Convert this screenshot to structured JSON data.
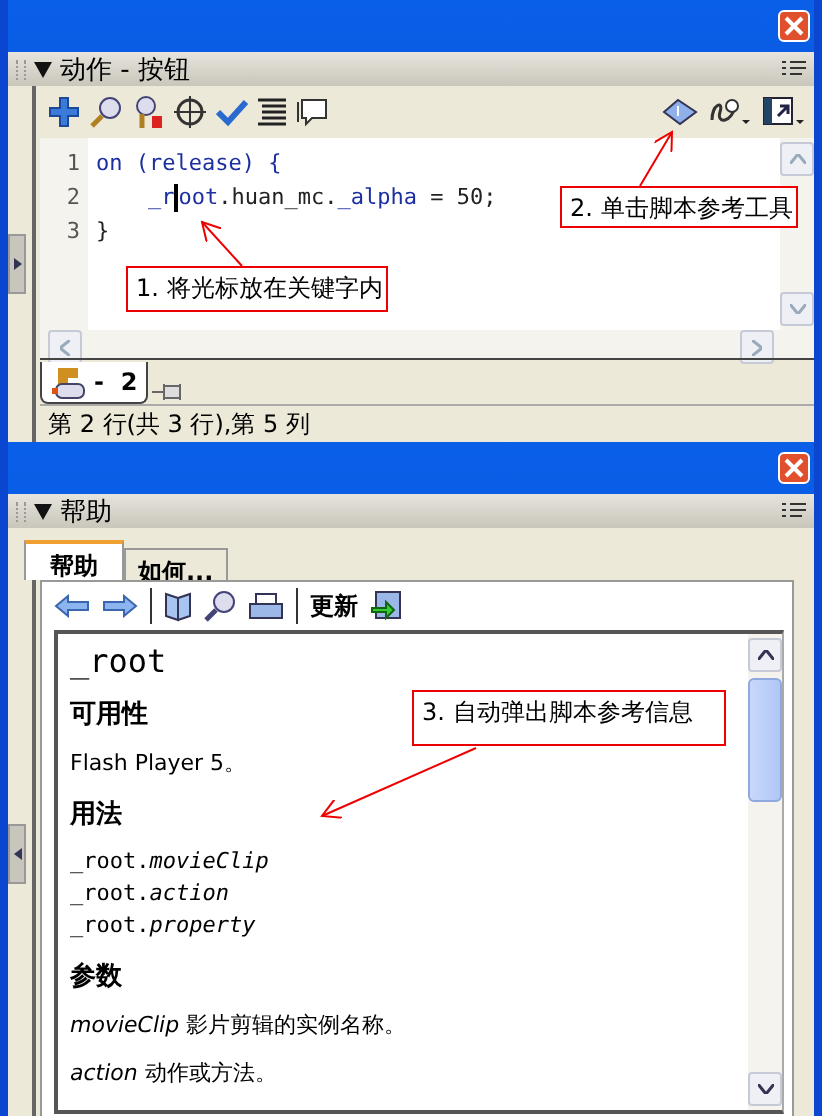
{
  "action_panel": {
    "header": "动作 - 按钮",
    "code_lines": [
      {
        "number": "1",
        "tokens": [
          {
            "kind": "keyword",
            "text": "on (release) {"
          }
        ]
      },
      {
        "number": "2",
        "indented": true,
        "tokens": [
          {
            "kind": "keyword",
            "text": "_r"
          },
          {
            "kind": "cursor"
          },
          {
            "kind": "keyword",
            "text": "oot"
          },
          {
            "kind": "plain",
            "text": ".huan_mc."
          },
          {
            "kind": "keyword",
            "text": "_alpha"
          },
          {
            "kind": "plain",
            "text": " = 50;"
          }
        ]
      },
      {
        "number": "3",
        "tokens": [
          {
            "kind": "plain",
            "text": "}"
          }
        ]
      }
    ],
    "script_tab": {
      "label": "-  2",
      "selected": true
    },
    "status": "第 2 行(共 3 行),第 5 列"
  },
  "help_panel": {
    "header": "帮助",
    "tabs": [
      {
        "label": "帮助",
        "selected": true
      },
      {
        "label": "如何...",
        "selected": false
      }
    ],
    "update_label": "更新",
    "content": [
      {
        "kind": "title",
        "text": "_root"
      },
      {
        "kind": "heading",
        "text": "可用性"
      },
      {
        "kind": "text",
        "text": "Flash Player 5。"
      },
      {
        "kind": "heading",
        "text": "用法"
      },
      {
        "kind": "code",
        "text": "_root.*movieClip*"
      },
      {
        "kind": "code",
        "text": "_root.*action*"
      },
      {
        "kind": "code",
        "text": "_root.*property*"
      },
      {
        "kind": "heading",
        "text": "参数"
      },
      {
        "kind": "text",
        "text": "*movieClip* 影片剪辑的实例名称。"
      },
      {
        "kind": "text",
        "text": "*action* 动作或方法。"
      }
    ]
  },
  "annotations": [
    {
      "text": "1. 将光标放在关键字内"
    },
    {
      "text": "2. 单击脚本参考工具"
    },
    {
      "text": "3. 自动弹出脚本参考信息"
    }
  ]
}
